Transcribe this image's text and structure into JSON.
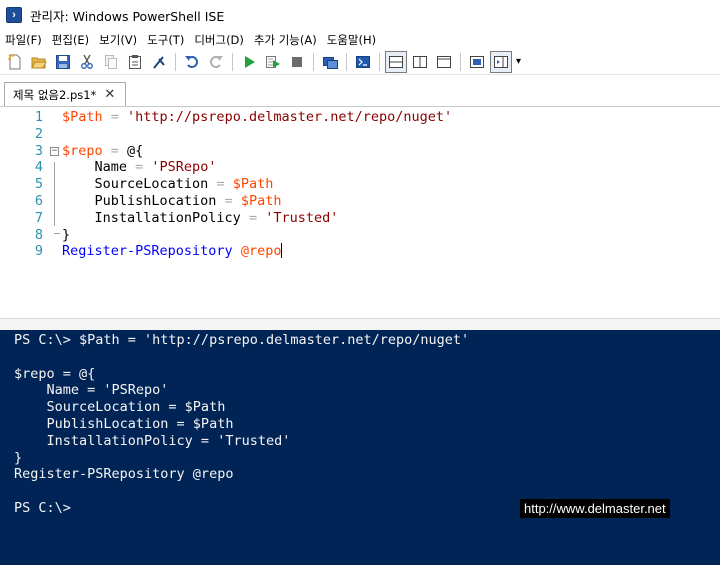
{
  "window": {
    "title": "관리자: Windows PowerShell ISE",
    "app_icon": "powershell-icon"
  },
  "menu": [
    {
      "label": "파일(F)"
    },
    {
      "label": "편집(E)"
    },
    {
      "label": "보기(V)"
    },
    {
      "label": "도구(T)"
    },
    {
      "label": "디버그(D)"
    },
    {
      "label": "추가 기능(A)"
    },
    {
      "label": "도움말(H)"
    }
  ],
  "toolbar": {
    "buttons": [
      "new-icon",
      "open-icon",
      "save-icon",
      "cut-icon",
      "copy-icon",
      "paste-icon",
      "clear-console-icon",
      "undo-icon",
      "redo-icon",
      "run-script-icon",
      "run-selection-icon",
      "stop-icon",
      "remote-powershell-icon",
      "start-powershell-icon",
      "show-script-top-icon",
      "show-script-right-icon",
      "show-script-maximized-icon",
      "show-command-window-icon",
      "show-command-addon-icon"
    ],
    "overflow": "▾"
  },
  "tab": {
    "label": "제목 없음2.ps1*",
    "close": "✕"
  },
  "editor": {
    "lines": [
      {
        "num": "1",
        "tokens": [
          [
            "var",
            "$Path"
          ],
          [
            "op",
            " = "
          ],
          [
            "str",
            "'http://psrepo.delmaster.net/repo/nuget'"
          ]
        ]
      },
      {
        "num": "2",
        "tokens": []
      },
      {
        "num": "3",
        "tokens": [
          [
            "var",
            "$repo"
          ],
          [
            "op",
            " = "
          ],
          [
            "plain",
            "@{"
          ]
        ]
      },
      {
        "num": "4",
        "tokens": [
          [
            "plain",
            "    Name"
          ],
          [
            "op",
            " = "
          ],
          [
            "str",
            "'PSRepo'"
          ]
        ]
      },
      {
        "num": "5",
        "tokens": [
          [
            "plain",
            "    SourceLocation"
          ],
          [
            "op",
            " = "
          ],
          [
            "var",
            "$Path"
          ]
        ]
      },
      {
        "num": "6",
        "tokens": [
          [
            "plain",
            "    PublishLocation"
          ],
          [
            "op",
            " = "
          ],
          [
            "var",
            "$Path"
          ]
        ]
      },
      {
        "num": "7",
        "tokens": [
          [
            "plain",
            "    InstallationPolicy"
          ],
          [
            "op",
            " = "
          ],
          [
            "str",
            "'Trusted'"
          ]
        ]
      },
      {
        "num": "8",
        "tokens": [
          [
            "plain",
            "}"
          ]
        ]
      },
      {
        "num": "9",
        "tokens": [
          [
            "cmd",
            "Register-PSRepository"
          ],
          [
            "plain",
            " "
          ],
          [
            "var",
            "@repo"
          ]
        ]
      }
    ],
    "fold_marker": "⊟"
  },
  "console": {
    "lines": [
      "PS C:\\> $Path = 'http://psrepo.delmaster.net/repo/nuget'",
      "",
      "$repo = @{",
      "    Name = 'PSRepo'",
      "    SourceLocation = $Path",
      "    PublishLocation = $Path",
      "    InstallationPolicy = 'Trusted'",
      "}",
      "Register-PSRepository @repo",
      "",
      "PS C:\\>"
    ]
  },
  "watermark": "http://www.delmaster.net"
}
